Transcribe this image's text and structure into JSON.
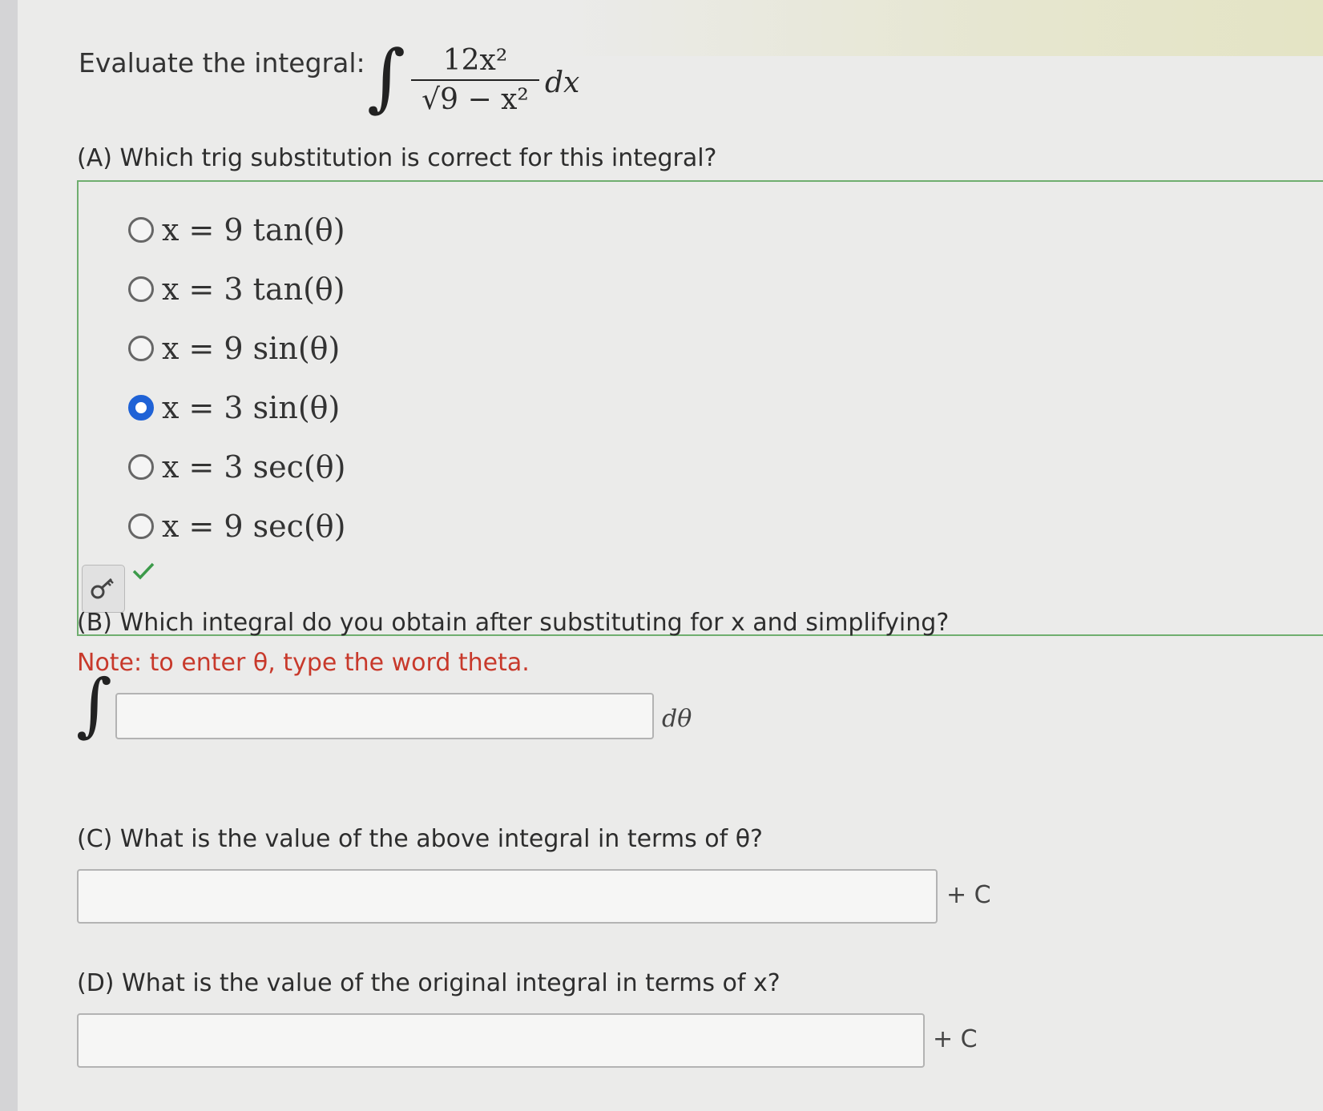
{
  "header": {
    "prompt": "Evaluate the integral:",
    "integrand_numerator": "12x²",
    "integrand_denominator": "√9 − x²",
    "differential": "dx"
  },
  "part_a": {
    "question": "(A) Which trig substitution is correct for this integral?",
    "choices": [
      {
        "label": "x = 9 tan(θ)",
        "selected": false
      },
      {
        "label": "x = 3 tan(θ)",
        "selected": false
      },
      {
        "label": "x = 9 sin(θ)",
        "selected": false
      },
      {
        "label": "x = 3 sin(θ)",
        "selected": true
      },
      {
        "label": "x = 3 sec(θ)",
        "selected": false
      },
      {
        "label": "x = 9 sec(θ)",
        "selected": false
      }
    ],
    "key_icon": "key-icon",
    "status_icon": "checkmark-icon",
    "status_color": "#3c9a4a"
  },
  "part_b": {
    "question": "(B) Which integral do you obtain after substituting for x and simplifying?",
    "note": "Note: to enter θ, type the word theta.",
    "input_value": "",
    "suffix": "dθ"
  },
  "part_c": {
    "question": "(C) What is the value of the above integral in terms of θ?",
    "input_value": "",
    "suffix": "+ C"
  },
  "part_d": {
    "question": "(D) What is the value of the original integral in terms of x?",
    "input_value": "",
    "suffix": "+ C"
  },
  "colors": {
    "accent_selected": "#1f62d6",
    "note_red": "#c8392b",
    "box_border_green": "#6fae6f"
  }
}
